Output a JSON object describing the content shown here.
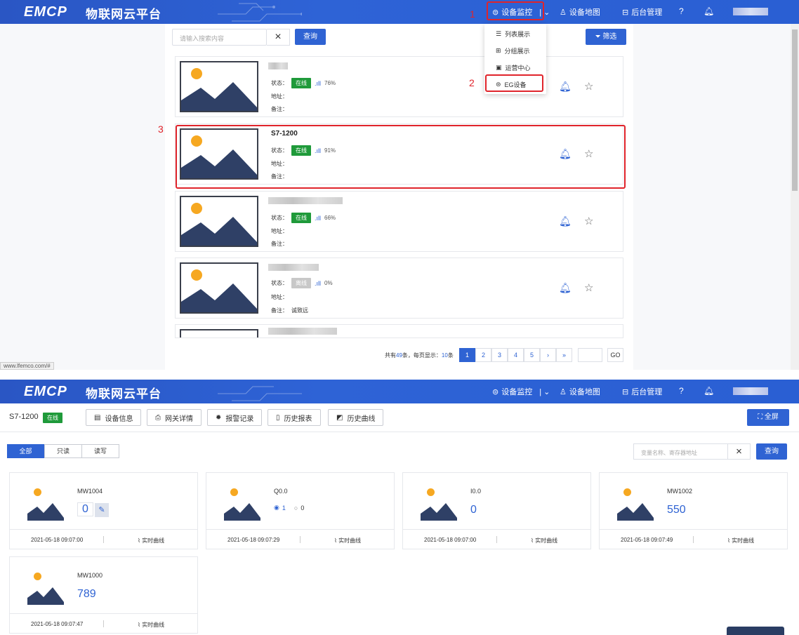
{
  "nav": {
    "logo": "EMCP",
    "logo_cn": "物联网云平台",
    "items": [
      "设备监控",
      "设备地图",
      "后台管理"
    ]
  },
  "list_page": {
    "search_placeholder": "请输入搜索内容",
    "query_label": "查询",
    "filter_label": "筛选",
    "field_status": "状态：",
    "field_address": "地址：",
    "field_note": "备注：",
    "devices": [
      {
        "name": "",
        "status": "在线",
        "signal": "76%",
        "address": "",
        "note": ""
      },
      {
        "name": "S7-1200",
        "status": "在线",
        "signal": "91%",
        "address": "",
        "note": ""
      },
      {
        "name": "",
        "status": "在线",
        "signal": "66%",
        "address": "",
        "note": ""
      },
      {
        "name": "",
        "status": "离线",
        "signal": "0%",
        "address": "",
        "note": "诚致远"
      }
    ],
    "pager": {
      "total_prefix": "共有",
      "total": "49",
      "total_mid": "条，每页显示：",
      "per_page": "10",
      "total_suffix": "条",
      "pages": [
        "1",
        "2",
        "3",
        "4",
        "5",
        "›",
        "»"
      ],
      "go": "GO"
    },
    "dropdown": [
      "列表展示",
      "分组展示",
      "运营中心",
      "EG设备"
    ],
    "markers": [
      "1",
      "2",
      "3"
    ],
    "status_url": "www.lfemco.com/#"
  },
  "detail_page": {
    "device_name": "S7-1200",
    "status": "在线",
    "tabs": [
      "设备信息",
      "网关详情",
      "报警记录",
      "历史报表",
      "历史曲线"
    ],
    "fullscreen": "全屏",
    "filters": [
      "全部",
      "只读",
      "读写"
    ],
    "search_placeholder": "变量名称、寄存器地址",
    "query_label": "查询",
    "curve_label": "实时曲线",
    "variables": [
      {
        "name": "MW1004",
        "value": "0",
        "time": "2021-05-18 09:07:00"
      },
      {
        "name": "Q0.0",
        "value": "1",
        "value_alt": "0",
        "time": "2021-05-18 09:07:29"
      },
      {
        "name": "I0.0",
        "value": "0",
        "time": "2021-05-18 09:07:00"
      },
      {
        "name": "MW1002",
        "value": "550",
        "time": "2021-05-18 09:07:49"
      },
      {
        "name": "MW1000",
        "value": "789",
        "time": "2021-05-18 09:07:47"
      }
    ]
  },
  "colors": {
    "primary": "#2f63d3",
    "online": "#1f9a3a",
    "offline": "#c8c8c8",
    "marker": "#e0242b"
  }
}
